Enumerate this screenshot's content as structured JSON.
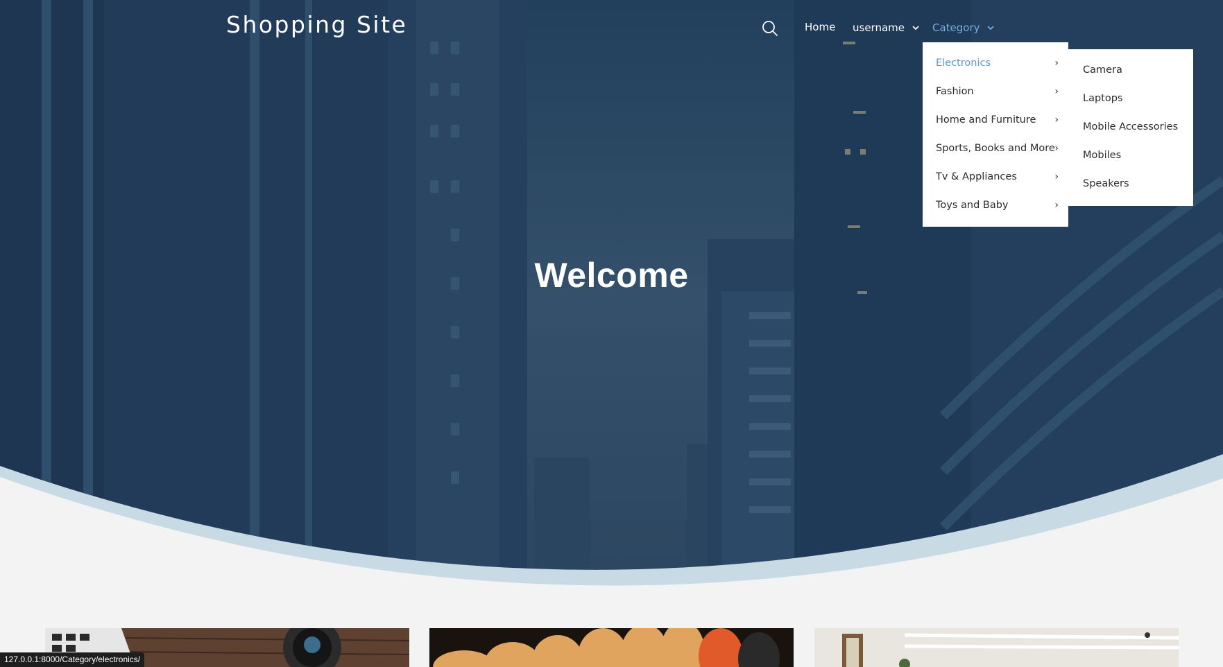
{
  "brand": "Shopping Site",
  "nav": {
    "search_icon": "search-icon",
    "home": "Home",
    "username": "username",
    "category": "Category"
  },
  "hero": {
    "title": "Welcome"
  },
  "category_menu": {
    "items": [
      {
        "label": "Electronics",
        "active": true
      },
      {
        "label": "Fashion",
        "active": false
      },
      {
        "label": "Home and Furniture",
        "active": false
      },
      {
        "label": "Sports, Books and More",
        "active": false
      },
      {
        "label": "Tv & Appliances",
        "active": false
      },
      {
        "label": "Toys and Baby",
        "active": false
      }
    ]
  },
  "electronics_submenu": {
    "items": [
      "Camera",
      "Laptops",
      "Mobile Accessories",
      "Mobiles",
      "Speakers"
    ]
  },
  "status_bar": {
    "url": "127.0.0.1:8000/Category/electronics/"
  },
  "colors": {
    "hero_overlay": "#1f3b57",
    "wave": "#c8dae4",
    "page_bg": "#f3f3f3",
    "accent": "#5a9bd0"
  }
}
